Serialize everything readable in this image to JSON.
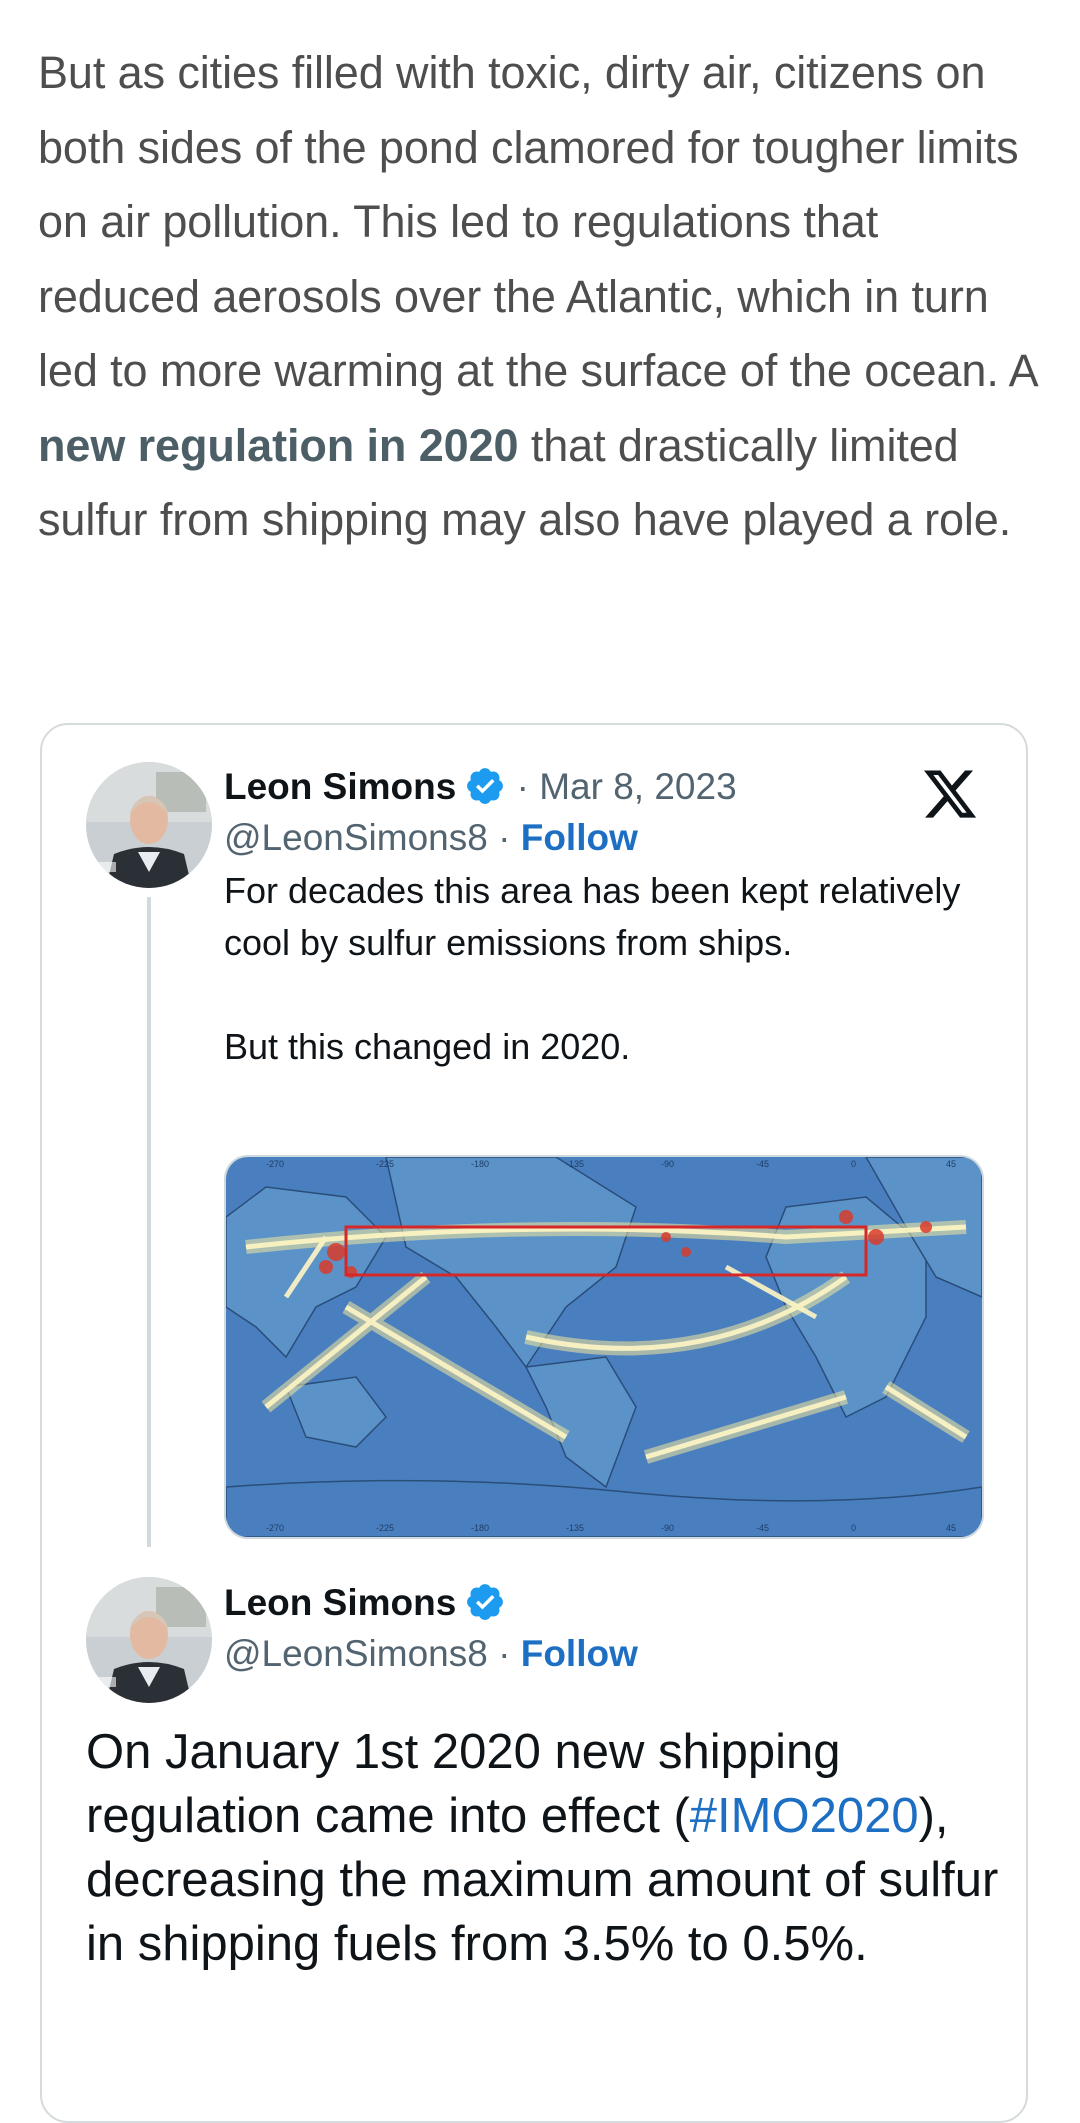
{
  "article": {
    "paragraph_start": "But as cities filled with toxic, dirty air, citizens on both sides of the pond clamored for tougher limits on air pollution. This led to regulations that reduced aerosols over the Atlantic, which in turn led to more warming at the surface of the ocean. A ",
    "link_text": "new regulation in 2020",
    "paragraph_end": " that drastically limited sulfur from shipping may also have played a role."
  },
  "embed": {
    "logo_icon": "x-logo-icon",
    "tweet1": {
      "author_name": "Leon Simons",
      "verified_icon": "verified-badge-icon",
      "date": "· Mar 8, 2023",
      "handle": "@LeonSimons8",
      "separator": "·",
      "follow_label": "Follow",
      "text": "For decades this area has been kept relatively cool by sulfur emissions from ships.\n\nBut this changed in 2020.",
      "map_axis_top": [
        "-270",
        "-225",
        "-180",
        "-135",
        "-90",
        "-45",
        "0",
        "45"
      ],
      "map_axis_bottom": [
        "-270",
        "-225",
        "-180",
        "-135",
        "-90",
        "-45",
        "0",
        "45"
      ]
    },
    "tweet2": {
      "author_name": "Leon Simons",
      "verified_icon": "verified-badge-icon",
      "handle": "@LeonSimons8",
      "separator": "·",
      "follow_label": "Follow",
      "text_start": "On January 1st 2020 new shipping regulation came into effect (",
      "hashtag": "#IMO2020",
      "text_end": "), decreasing the maximum amount of sulfur in shipping fuels from 3.5% to 0.5%."
    }
  },
  "colors": {
    "article_text": "#4e4e4e",
    "article_link": "#4d5f66",
    "follow_link": "#1d6fc4",
    "verified_blue": "#1d9bf0",
    "map_ocean": "#4a7fbf"
  }
}
